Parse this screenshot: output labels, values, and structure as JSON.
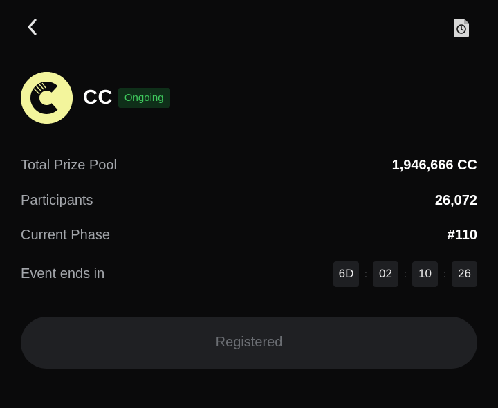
{
  "nav": {
    "back_icon": "chevron-left-icon",
    "history_icon": "document-clock-icon"
  },
  "token": {
    "name": "CC",
    "status": "Ongoing",
    "logo_icon": "cc-coin-logo",
    "colors": {
      "logo_bg": "#f3f59c",
      "status_text": "#3fc95d",
      "status_bg": "#0f2f19"
    }
  },
  "stats": {
    "prize_pool_label": "Total Prize Pool",
    "prize_pool_value": "1,946,666 CC",
    "participants_label": "Participants",
    "participants_value": "26,072",
    "phase_label": "Current Phase",
    "phase_value": "#110",
    "ends_label": "Event ends in"
  },
  "countdown": {
    "days": "6D",
    "hours": "02",
    "minutes": "10",
    "seconds": "26",
    "separator": ":"
  },
  "action": {
    "button_label": "Registered"
  }
}
